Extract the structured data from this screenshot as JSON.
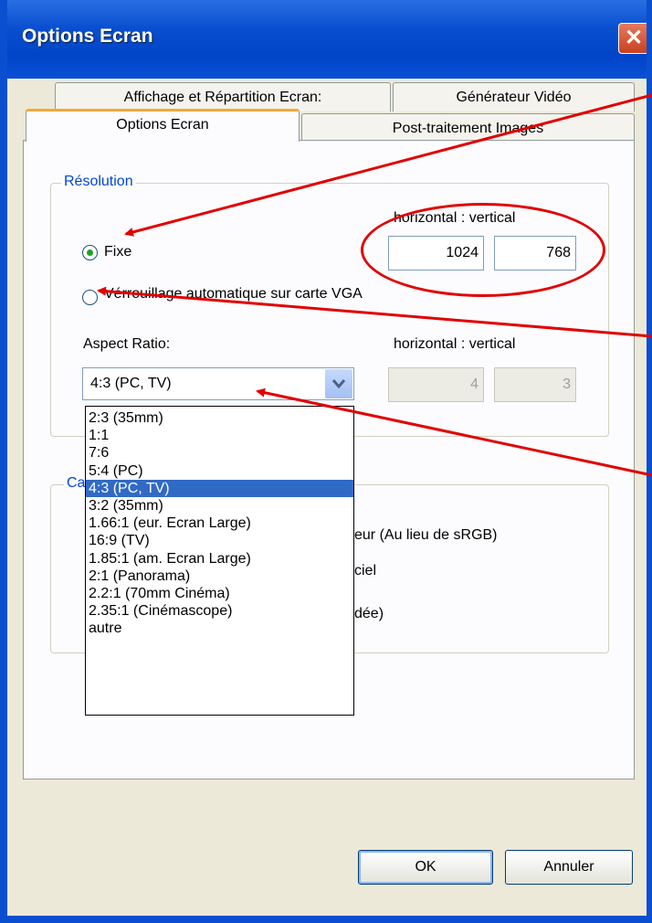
{
  "window": {
    "title": "Options Ecran",
    "close_glyph": "✕"
  },
  "tabs": [
    {
      "label": "Affichage et Répartition Ecran:"
    },
    {
      "label": "Générateur Vidéo"
    },
    {
      "label": "Options Ecran"
    },
    {
      "label": "Post-traitement Images"
    }
  ],
  "resolution": {
    "group_label": "Résolution",
    "hv_label": "horizontal : vertical",
    "fixed_label": "Fixe",
    "fixed_checked": true,
    "horizontal": "1024",
    "vertical": "768",
    "auto_label": "Vérrouillage automatique sur carte VGA",
    "aspect_label": "Aspect Ratio:",
    "aspect_hv_label": "horizontal : vertical",
    "aspect_selected": "4:3 (PC, TV)",
    "aspect_h": "4",
    "aspect_v": "3",
    "options": [
      "2:3 (35mm)",
      "1:1",
      "7:6",
      "5:4 (PC)",
      "4:3 (PC, TV)",
      "3:2 (35mm)",
      "1.66:1 (eur. Ecran Large)",
      "16:9 (TV)",
      "1.85:1 (am. Ecran Large)",
      "2:1 (Panorama)",
      "2.2:1 (70mm Cinéma)",
      "2.35:1 (Cinémascope)",
      "autre"
    ],
    "selected_index": 4
  },
  "colors": {
    "group_label_blue": "#0046d5",
    "selection_blue": "#316ac5",
    "annotation_red": "#e10000",
    "radio_green": "#21a121"
  },
  "second_group": {
    "label_fragment": "Ca",
    "line1_fragment": "eur (Au lieu de sRGB)",
    "line2_fragment": "ciel",
    "line3_fragment": "dée)"
  },
  "buttons": {
    "ok": "OK",
    "cancel": "Annuler"
  }
}
